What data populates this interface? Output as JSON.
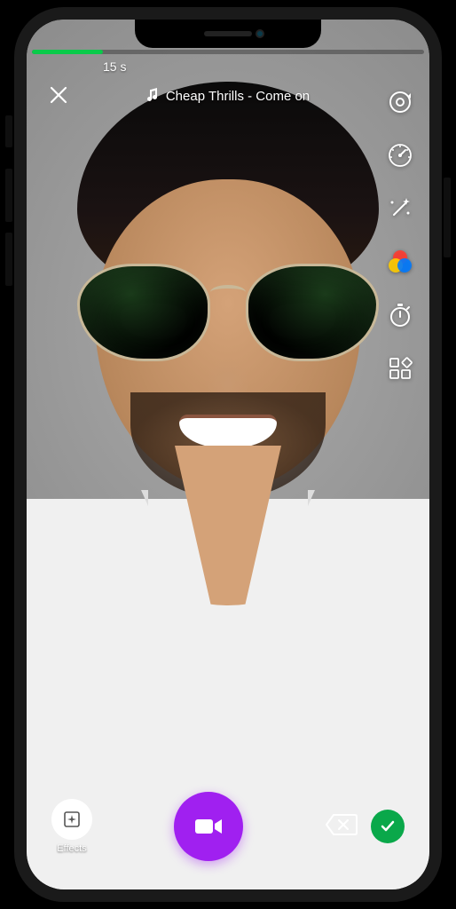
{
  "recording": {
    "duration_label": "15 s",
    "progress_percent": 18
  },
  "music": {
    "track_label": "Cheap Thrills - Come on"
  },
  "effects": {
    "button_label": "Effects"
  },
  "right_controls": {
    "flip_camera": "flip-camera",
    "speed": "speed",
    "beauty": "beauty-wand",
    "filters": "color-filters",
    "timer": "timer",
    "more": "grid-more"
  },
  "ar_filter": {
    "applied": "aviator-sunglasses"
  },
  "colors": {
    "accent_purple": "#a020f0",
    "accent_green": "#0aca4a",
    "confirm_green": "#0aa84a"
  }
}
